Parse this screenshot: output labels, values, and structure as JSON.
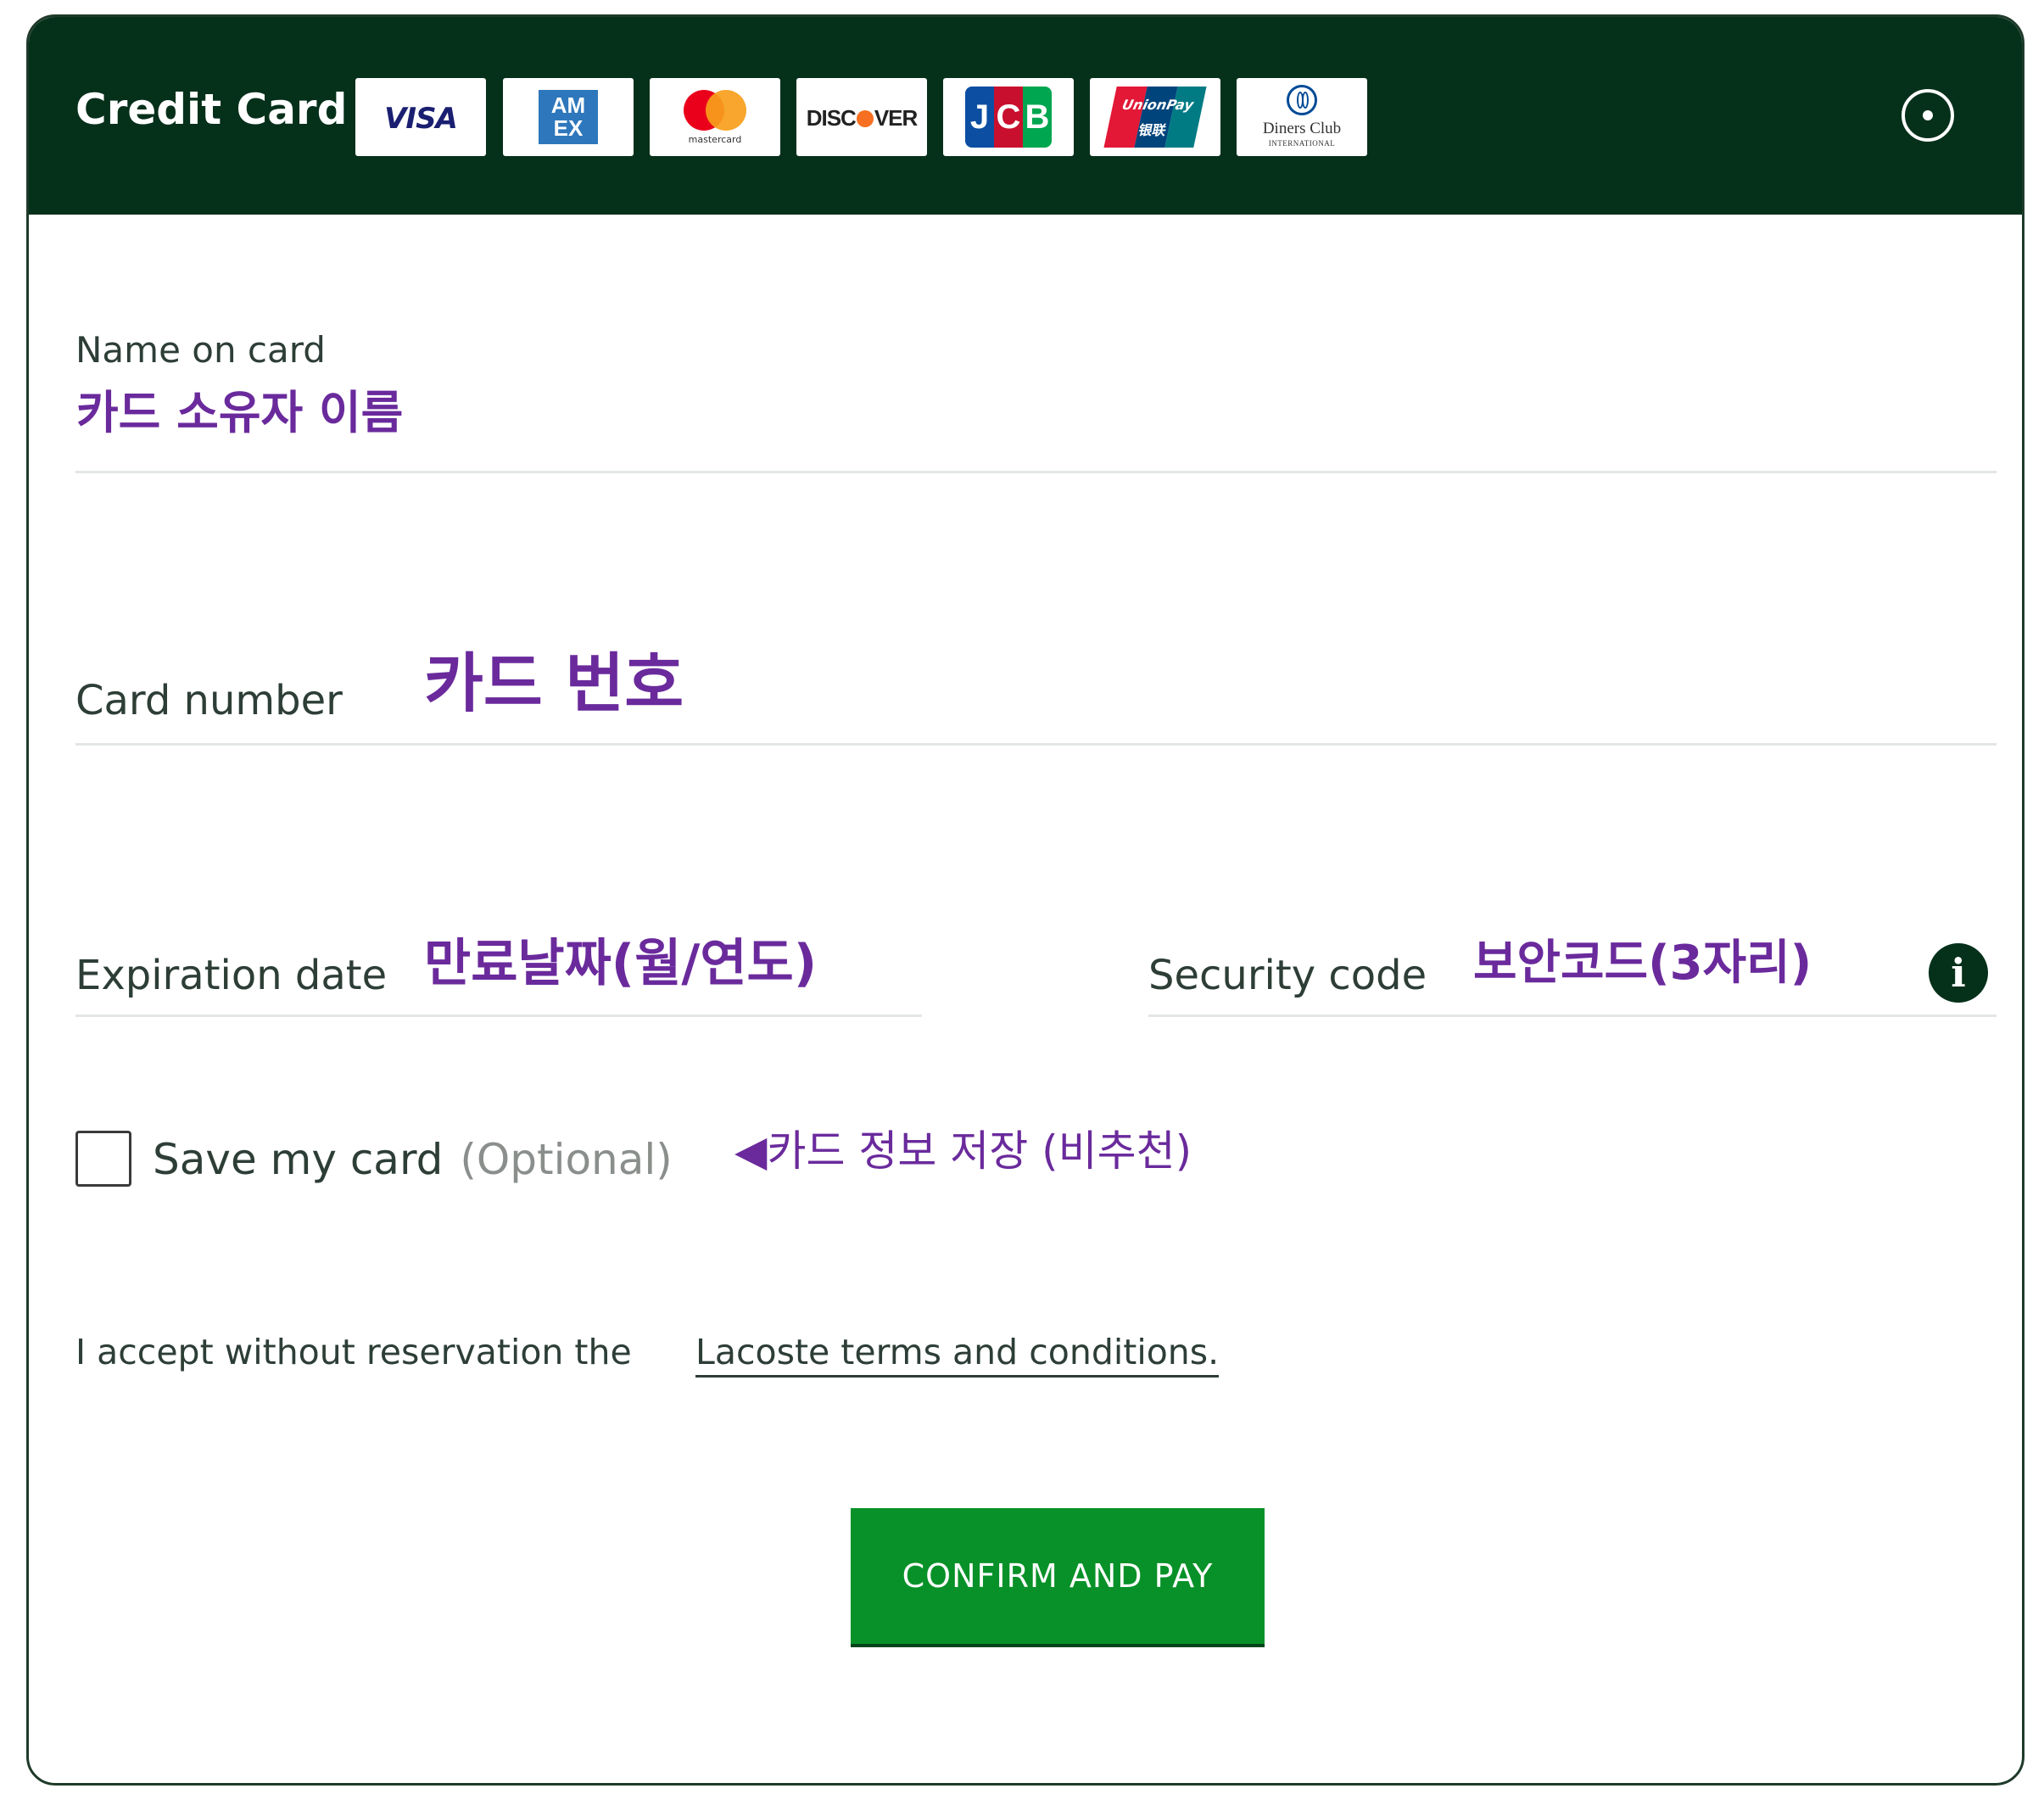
{
  "header": {
    "title": "Credit Card",
    "payment_logos": [
      {
        "name": "visa",
        "text": "VISA",
        "color": "#1a1f71"
      },
      {
        "name": "amex",
        "text_line1": "AM",
        "text_line2": "EX",
        "color": "#2e77bc"
      },
      {
        "name": "mastercard",
        "caption": "mastercard",
        "colors": [
          "#eb001b",
          "#f79e1b"
        ]
      },
      {
        "name": "discover",
        "text_a": "DISC",
        "text_b": "VER",
        "accent": "#f76f20"
      },
      {
        "name": "jcb",
        "letters": [
          "J",
          "C",
          "B"
        ],
        "colors": [
          "#0b4ea2",
          "#c8102e",
          "#00a650"
        ]
      },
      {
        "name": "unionpay",
        "text_line1": "UnionPay",
        "text_line2": "银联",
        "colors": [
          "#e21836",
          "#00447c",
          "#007b84"
        ]
      },
      {
        "name": "diners-club",
        "text_line1": "Diners Club",
        "text_line2": "INTERNATIONAL",
        "color": "#004a97"
      }
    ]
  },
  "form": {
    "name_on_card": {
      "label": "Name on card",
      "annotation": "카드 소유자 이름"
    },
    "card_number": {
      "label": "Card number",
      "annotation": "카드 번호"
    },
    "expiration_date": {
      "label": "Expiration date",
      "annotation": "만료날짜(월/연도)"
    },
    "security_code": {
      "label": "Security code",
      "annotation": "보안코드(3자리)",
      "info_icon": "i"
    },
    "save_card": {
      "label": "Save my card",
      "optional": "(Optional)",
      "annotation": "◀카드 정보 저장 (비추천)",
      "checked": false
    },
    "terms": {
      "prefix": "I accept without reservation the ",
      "link": "Lacoste terms and conditions."
    },
    "confirm_button": "CONFIRM AND PAY"
  },
  "colors": {
    "header_bg": "#05301a",
    "annotation": "#6a2a9c",
    "button_bg": "#079128",
    "text": "#2d3e36"
  }
}
